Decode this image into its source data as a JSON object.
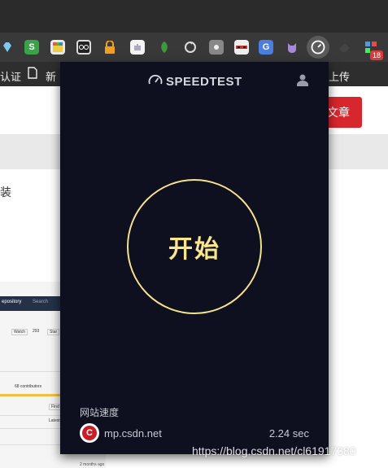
{
  "colors": {
    "popup_bg": "#0e1020",
    "accent_yellow": "#f5e28c",
    "csdn_red": "#c91e26",
    "page_button_red": "#d8262d"
  },
  "browser": {
    "bookmarks": {
      "item_left": "认证",
      "item_new": "新",
      "item_right": "上传"
    },
    "extensions": [
      "gem-icon",
      "s-icon",
      "palette-icon",
      "binoculars-icon",
      "lock-icon",
      "puzzle-icon",
      "leaf-icon",
      "refresh-icon",
      "gear-icon",
      "mask-icon",
      "translate-icon",
      "cat-icon",
      "speedtest-icon",
      "eraser-icon",
      "grid-icon"
    ],
    "extension_badge": "18"
  },
  "page": {
    "publish_button": "文章",
    "text_snippet": "装",
    "thumb": {
      "repo_label": "epository",
      "search_label": "Search",
      "watch": "Watch",
      "watch_count": "293",
      "star": "Star",
      "contributors": "68 contributors",
      "find": "Find",
      "latest": "Latest",
      "time": "2 months ago"
    }
  },
  "speedtest": {
    "logo_text": "SPEEDTEST",
    "go_label": "开始",
    "site_section_label": "网站速度",
    "site": {
      "icon_letter": "C",
      "host": "mp.csdn.net",
      "time": "2.24 sec"
    }
  },
  "watermark": "https://blog.csdn.net/cl61917380"
}
